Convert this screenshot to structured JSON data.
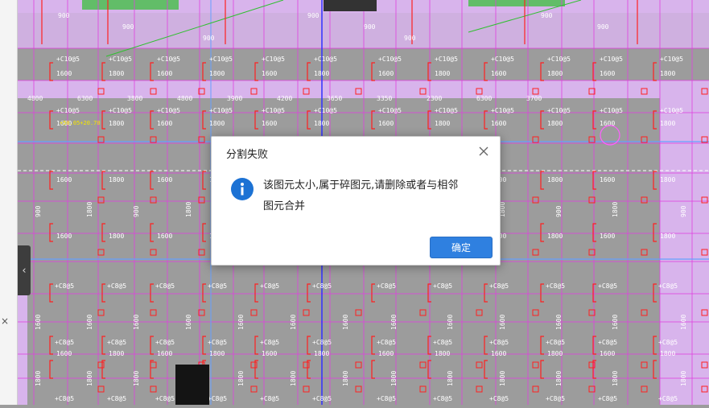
{
  "dialog": {
    "title": "分割失败",
    "message_line1": "该图元太小,属于碎图元,请删除或者与相邻",
    "message_line2": "图元合并",
    "ok_label": "确定",
    "close_icon": "close-icon",
    "info_icon": "info-icon"
  },
  "side_panel": {
    "collapse_glyph": "‹",
    "close_glyph": "×"
  },
  "drawing": {
    "bg_color": "#9c9c9c",
    "zone_color": "#d8b4ec",
    "grid_color": "#e040e0",
    "axis_color": "#66a0ff",
    "line_color": "#ff2020",
    "green_color": "#30c030",
    "text_color": "#ffffff",
    "rebar_top_labels": [
      "+C10@5",
      "+C10@5",
      "+C10@5",
      "+C10@5",
      "+C10@5",
      "+C10@5",
      "+C10@5",
      "+C10@5",
      "+C10@5",
      "+C10@5",
      "+C10@5",
      "+C10@5"
    ],
    "rebar_mid_labels": [
      "+C8@5",
      "+C8@5",
      "+C8@5",
      "+C8@5",
      "+C8@5",
      "+C8@5",
      "+C8@5"
    ],
    "dim_1600": "1600",
    "dim_1800": "1800",
    "dim_900": "900",
    "dim_row": [
      "4800",
      "6300",
      "3800",
      "4800",
      "3900",
      "4200",
      "3650",
      "3350",
      "2300",
      "6300",
      "3700"
    ],
    "yellow_note": "+50.05+20.70"
  }
}
